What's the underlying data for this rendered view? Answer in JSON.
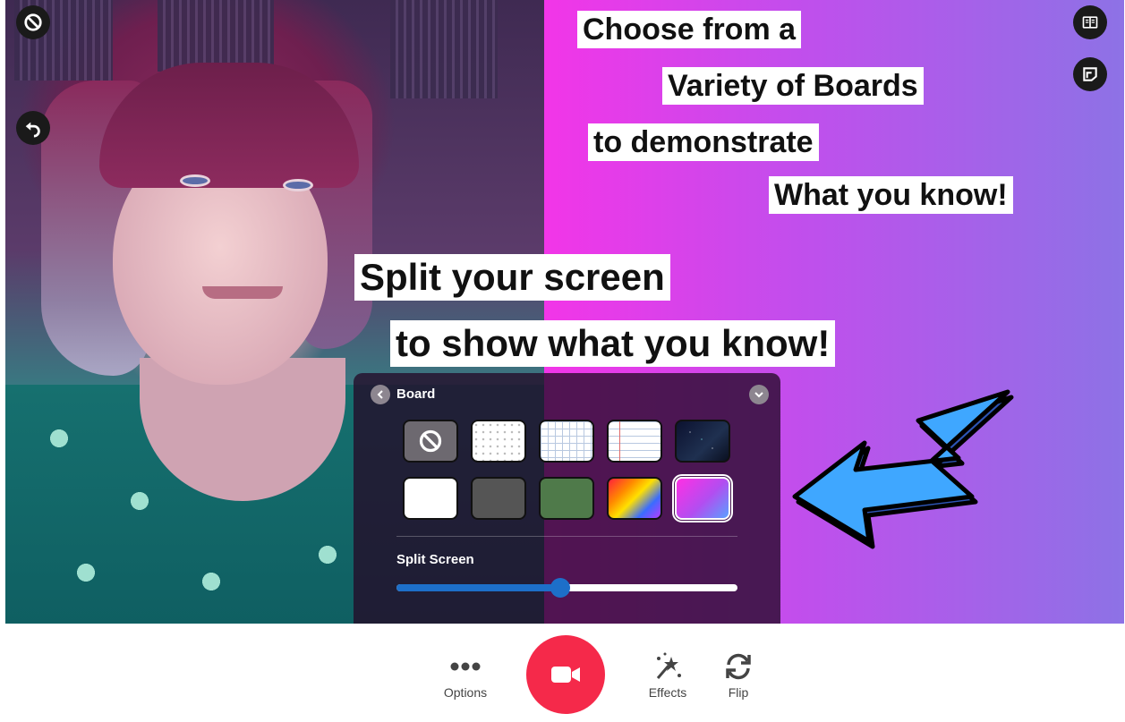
{
  "captions": {
    "line1": "Choose from a",
    "line2": "Variety of Boards",
    "line3": "to demonstrate",
    "line4": "What you know!",
    "line5": "Split your screen",
    "line6": "to show what you know!"
  },
  "corner_buttons": {
    "top_left": "disable-icon",
    "undo": "undo-icon",
    "top_right_1": "book-icon",
    "top_right_2": "sticky-note-icon"
  },
  "panel": {
    "title": "Board",
    "boards": [
      {
        "name": "none",
        "icon": "none-icon"
      },
      {
        "name": "dots",
        "color": "#ffffff"
      },
      {
        "name": "grid",
        "color": "#ffffff"
      },
      {
        "name": "lined",
        "color": "#ffffff"
      },
      {
        "name": "space",
        "color": "#1a1f3a"
      },
      {
        "name": "white",
        "color": "#ffffff"
      },
      {
        "name": "gray",
        "color": "#555555"
      },
      {
        "name": "green",
        "color": "#4f7a4a"
      },
      {
        "name": "rainbow",
        "color": "#ff6a00"
      },
      {
        "name": "gradient",
        "color": "#e935e8",
        "selected": true
      }
    ],
    "split_label": "Split Screen",
    "split_value": 0.48
  },
  "toolbar": {
    "options_label": "Options",
    "effects_label": "Effects",
    "flip_label": "Flip"
  },
  "colors": {
    "record": "#f5294a",
    "slider": "#1d6fc9",
    "board_gradient_start": "#f235e8",
    "board_gradient_end": "#8d72e6"
  }
}
